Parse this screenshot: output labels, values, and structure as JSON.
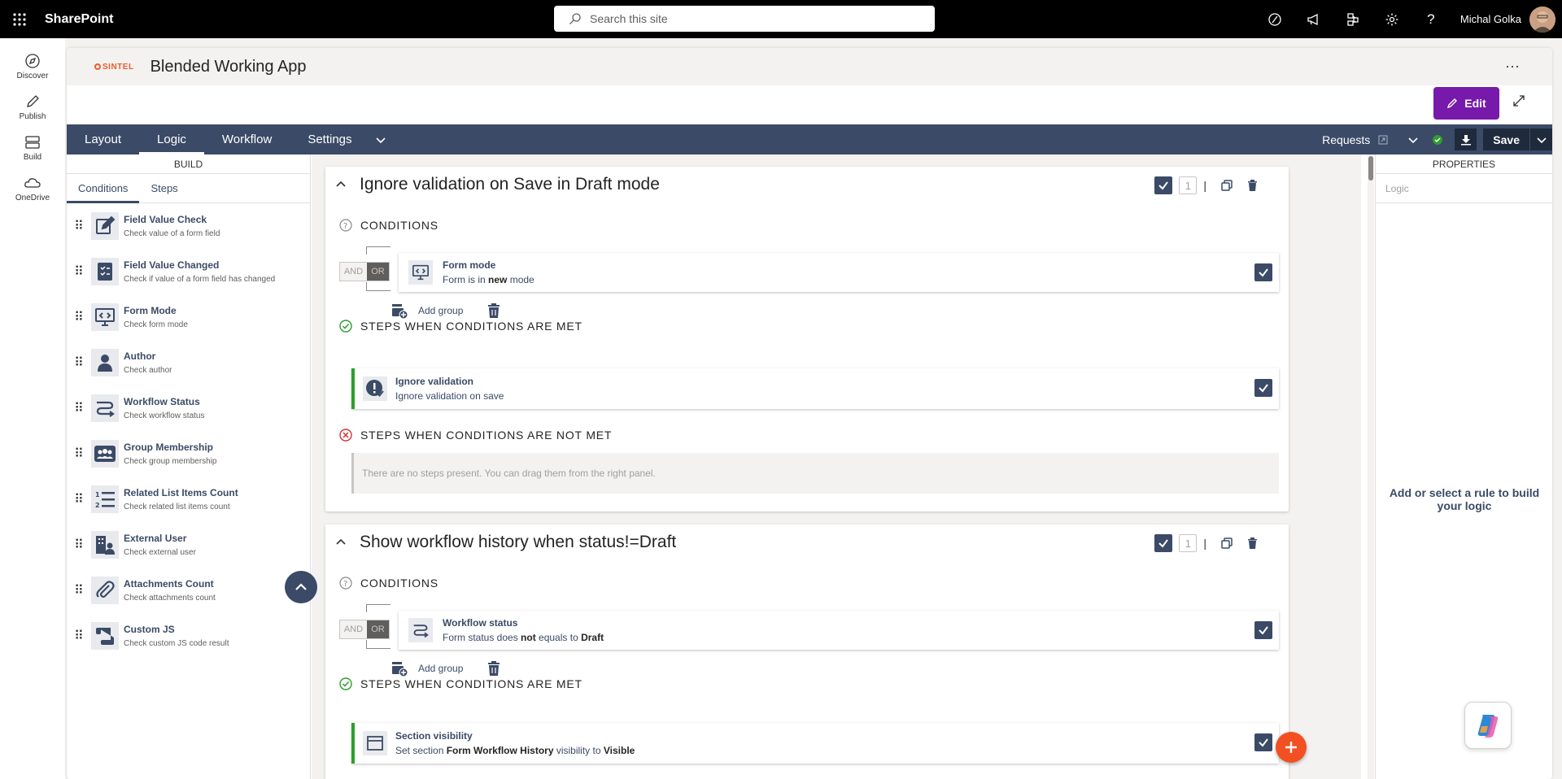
{
  "suite": {
    "brand": "SharePoint",
    "search_placeholder": "Search this site",
    "user_name": "Michal Golka",
    "icons": [
      "copilot-ring-icon",
      "megaphone-icon",
      "share-network-icon",
      "gear-icon",
      "help-icon"
    ]
  },
  "appbar": {
    "items": [
      {
        "label": "Discover"
      },
      {
        "label": "Publish"
      },
      {
        "label": "Build"
      },
      {
        "label": "OneDrive"
      }
    ]
  },
  "header": {
    "logo_text": "SINTEL",
    "title": "Blended Working App",
    "more": "···",
    "edit_label": "Edit"
  },
  "toolbar": {
    "tabs": [
      "Layout",
      "Logic",
      "Workflow",
      "Settings"
    ],
    "active_tab": "Logic",
    "list_name": "Requests",
    "save_label": "Save"
  },
  "build_panel": {
    "header": "BUILD",
    "tabs": [
      "Conditions",
      "Steps"
    ],
    "active_tab": "Conditions",
    "items": [
      {
        "title": "Field Value Check",
        "subtitle": "Check value of a form field",
        "icon": "edit-icon"
      },
      {
        "title": "Field Value Changed",
        "subtitle": "Check if value of a form field has changed",
        "icon": "checklist-icon"
      },
      {
        "title": "Form Mode",
        "subtitle": "Check form mode",
        "icon": "monitor-icon"
      },
      {
        "title": "Author",
        "subtitle": "Check author",
        "icon": "person-icon"
      },
      {
        "title": "Workflow Status",
        "subtitle": "Check workflow status",
        "icon": "flow-icon"
      },
      {
        "title": "Group Membership",
        "subtitle": "Check group membership",
        "icon": "group-icon"
      },
      {
        "title": "Related List Items Count",
        "subtitle": "Check related list items count",
        "icon": "list-count-icon"
      },
      {
        "title": "External User",
        "subtitle": "Check external user",
        "icon": "external-user-icon"
      },
      {
        "title": "Attachments Count",
        "subtitle": "Check attachments count",
        "icon": "paperclip-icon"
      },
      {
        "title": "Custom JS",
        "subtitle": "Check custom JS code result",
        "icon": "script-icon"
      }
    ]
  },
  "rules": [
    {
      "title": "Ignore validation on Save in Draft mode",
      "order": "1",
      "conditions_label": "CONDITIONS",
      "and_label": "AND",
      "or_label": "OR",
      "condition": {
        "title": "Form mode",
        "pre": "Form is in ",
        "bold": "new",
        "post": " mode"
      },
      "add_group": "Add group",
      "met_label": "STEPS WHEN CONDITIONS ARE MET",
      "step": {
        "title": "Ignore validation",
        "subtitle": "Ignore validation on save"
      },
      "not_met_label": "STEPS WHEN CONDITIONS ARE NOT MET",
      "empty_text": "There are no steps present. You can drag them from the right panel."
    },
    {
      "title": "Show workflow history when status!=Draft",
      "order": "1",
      "conditions_label": "CONDITIONS",
      "and_label": "AND",
      "or_label": "OR",
      "condition": {
        "title": "Workflow status",
        "pre": "Form status does ",
        "bold": "not",
        "mid": " equals to ",
        "bold2": "Draft"
      },
      "add_group": "Add group",
      "met_label": "STEPS WHEN CONDITIONS ARE MET",
      "step": {
        "title": "Section visibility",
        "pre": "Set section ",
        "bold": "Form Workflow History",
        "mid": " visibility to ",
        "bold2": "Visible"
      }
    }
  ],
  "properties": {
    "header": "PROPERTIES",
    "tab": "Logic",
    "empty_text": "Add or select a rule to build your logic"
  },
  "colors": {
    "accent": "#3b4a66",
    "edit": "#7719aa",
    "success": "#2e9e2e",
    "error": "#d13438",
    "fab": "#f25022"
  }
}
